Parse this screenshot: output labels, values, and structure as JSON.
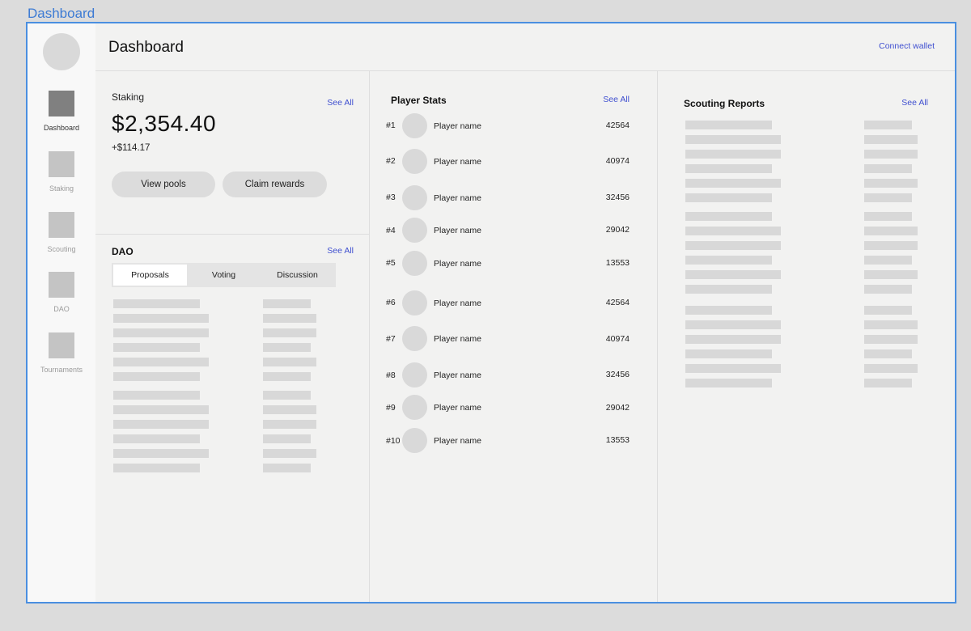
{
  "frame_label": "Dashboard",
  "sidebar": {
    "items": [
      {
        "label": "Dashboard",
        "active": true
      },
      {
        "label": "Staking",
        "active": false
      },
      {
        "label": "Scouting",
        "active": false
      },
      {
        "label": "DAO",
        "active": false
      },
      {
        "label": "Tournaments",
        "active": false
      }
    ]
  },
  "header": {
    "title": "Dashboard",
    "connect_wallet": "Connect wallet"
  },
  "staking": {
    "title": "Staking",
    "see_all": "See All",
    "balance": "$2,354.40",
    "change": "+$114.17",
    "view_pools": "View pools",
    "claim_rewards": "Claim rewards"
  },
  "dao": {
    "title": "DAO",
    "see_all": "See All",
    "tabs": [
      {
        "label": "Proposals",
        "active": true
      },
      {
        "label": "Voting",
        "active": false
      },
      {
        "label": "Discussion",
        "active": false
      }
    ]
  },
  "player_stats": {
    "title": "Player Stats",
    "see_all": "See All",
    "players": [
      {
        "rank": "#1",
        "name": "Player name",
        "score": "42564"
      },
      {
        "rank": "#2",
        "name": "Player name",
        "score": "40974"
      },
      {
        "rank": "#3",
        "name": "Player name",
        "score": "32456"
      },
      {
        "rank": "#4",
        "name": "Player name",
        "score": "29042"
      },
      {
        "rank": "#5",
        "name": "Player name",
        "score": "13553"
      },
      {
        "rank": "#6",
        "name": "Player name",
        "score": "42564"
      },
      {
        "rank": "#7",
        "name": "Player name",
        "score": "40974"
      },
      {
        "rank": "#8",
        "name": "Player name",
        "score": "32456"
      },
      {
        "rank": "#9",
        "name": "Player name",
        "score": "29042"
      },
      {
        "rank": "#10",
        "name": "Player name",
        "score": "13553"
      }
    ]
  },
  "scouting_reports": {
    "title": "Scouting Reports",
    "see_all": "See All"
  }
}
